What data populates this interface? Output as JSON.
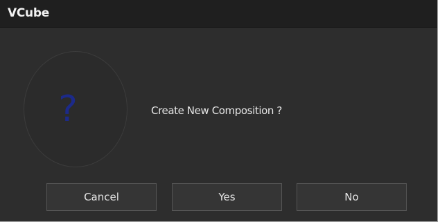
{
  "window": {
    "title": "VCube"
  },
  "dialog": {
    "icon": "question-icon",
    "icon_glyph": "?",
    "icon_color": "#1c2a8a",
    "message": "Create New Composition ?"
  },
  "buttons": {
    "cancel_label": "Cancel",
    "yes_label": "Yes",
    "no_label": "No"
  },
  "colors": {
    "background": "#2d2d2d",
    "titlebar": "#1f1f1f",
    "button_bg": "#353535",
    "button_border": "#555555",
    "text": "#e6e6e6"
  }
}
